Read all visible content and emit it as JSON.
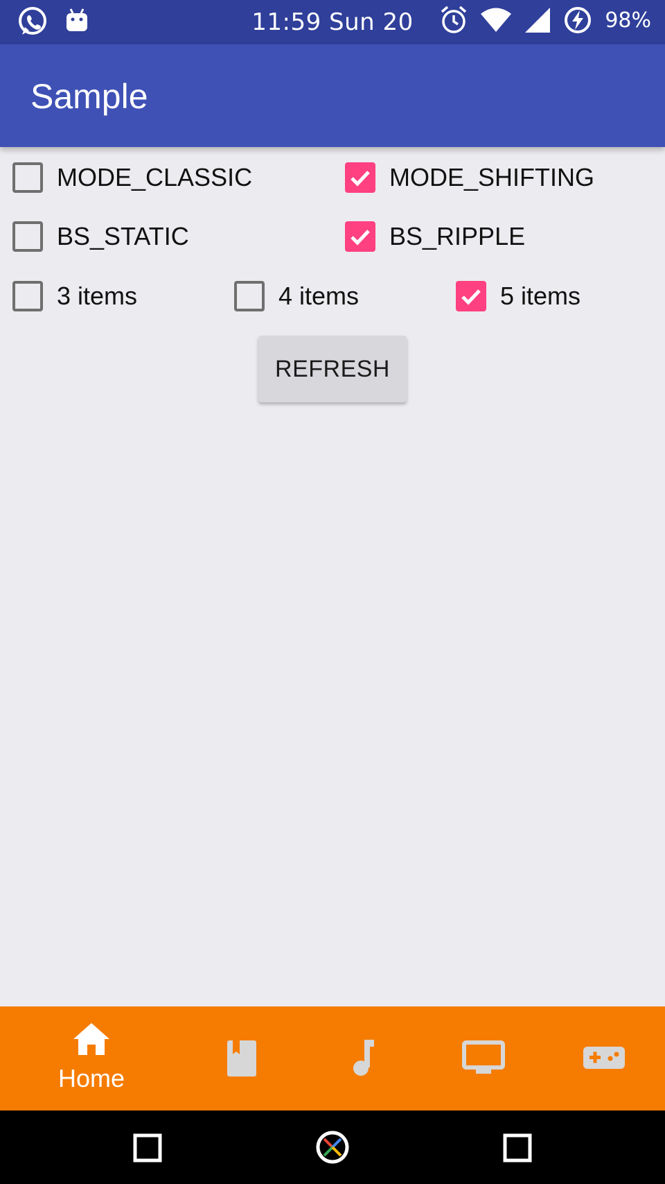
{
  "status_bar": {
    "time": "11:59 Sun 20",
    "battery": "98%",
    "icons": [
      "whatsapp-icon",
      "android-icon",
      "alarm-icon",
      "wifi-icon",
      "signal-icon",
      "battery-charging-icon"
    ]
  },
  "app_bar": {
    "title": "Sample"
  },
  "options": {
    "mode_classic": {
      "label": "MODE_CLASSIC",
      "checked": false
    },
    "mode_shifting": {
      "label": "MODE_SHIFTING",
      "checked": true
    },
    "bs_static": {
      "label": "BS_STATIC",
      "checked": false
    },
    "bs_ripple": {
      "label": "BS_RIPPLE",
      "checked": true
    },
    "items_3": {
      "label": "3 items",
      "checked": false
    },
    "items_4": {
      "label": "4 items",
      "checked": false
    },
    "items_5": {
      "label": "5 items",
      "checked": true
    }
  },
  "refresh_label": "REFRESH",
  "bottom_nav": {
    "background": "#f57c00",
    "items": [
      {
        "label": "Home",
        "icon": "home-icon",
        "active": true
      },
      {
        "label": "",
        "icon": "book-icon",
        "active": false
      },
      {
        "label": "",
        "icon": "music-note-icon",
        "active": false
      },
      {
        "label": "",
        "icon": "tv-icon",
        "active": false
      },
      {
        "label": "",
        "icon": "gamepad-icon",
        "active": false
      }
    ]
  },
  "colors": {
    "status_bar": "#2f3f9a",
    "app_bar": "#3f51b5",
    "checkbox_accent": "#ff4081",
    "background": "#ecebef"
  },
  "system_nav": {
    "icons": [
      "back-square-icon",
      "home-circle-icon",
      "recents-square-icon"
    ]
  }
}
